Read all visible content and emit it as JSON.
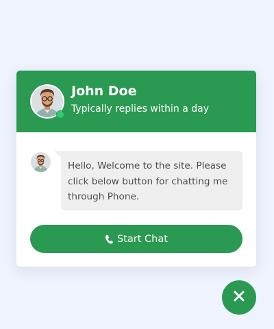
{
  "header": {
    "agent_name": "John Doe",
    "status_text": "Typically replies within a day"
  },
  "message": {
    "text": "Hello, Welcome to the site. Please click below button for chatting me through Phone."
  },
  "start_button": {
    "label": "Start Chat",
    "icon": "phone-icon"
  },
  "close_button": {
    "icon": "close-icon"
  },
  "colors": {
    "accent": "#2a9951",
    "online": "#2ecc71",
    "background": "#eef3fd",
    "bubble": "#efefef"
  }
}
